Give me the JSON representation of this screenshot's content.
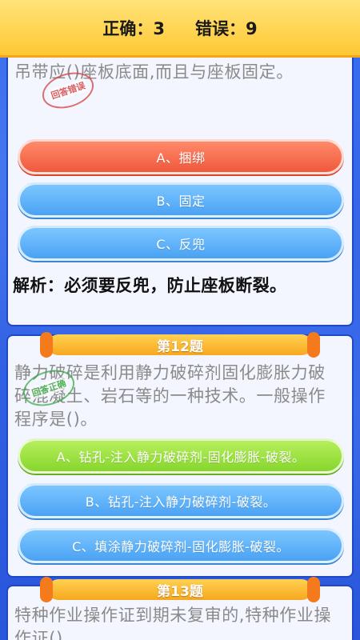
{
  "score": {
    "correct_label": "正确：",
    "correct_value": "3",
    "wrong_label": "错误：",
    "wrong_value": "9"
  },
  "q11": {
    "text": "吊带应()座板底面,而且与座板固定。",
    "stamp": "回答错误",
    "options": [
      "A、捆绑",
      "B、固定",
      "C、反兜"
    ],
    "explanation": "解析：必须要反兜，防止座板断裂。"
  },
  "q12": {
    "label": "第12题",
    "text": "静力破碎是利用静力破碎剂固化膨胀力破碎混凝土、岩石等的一种技术。一般操作程序是()。",
    "stamp": "回答正确",
    "options": [
      "A、钻孔-注入静力破碎剂-固化膨胀-破裂。",
      "B、钻孔-注入静力破碎剂-破裂。",
      "C、填涂静力破碎剂-固化膨胀-破裂。"
    ]
  },
  "q13": {
    "label": "第13题",
    "text": "特种作业操作证到期未复审的,特种作业操作证()"
  },
  "colors": {
    "background": "#2f63e6",
    "header": "#ffc833",
    "wrong": "#f0583c",
    "neutral": "#4aa2f4",
    "correct": "#86d62d"
  }
}
